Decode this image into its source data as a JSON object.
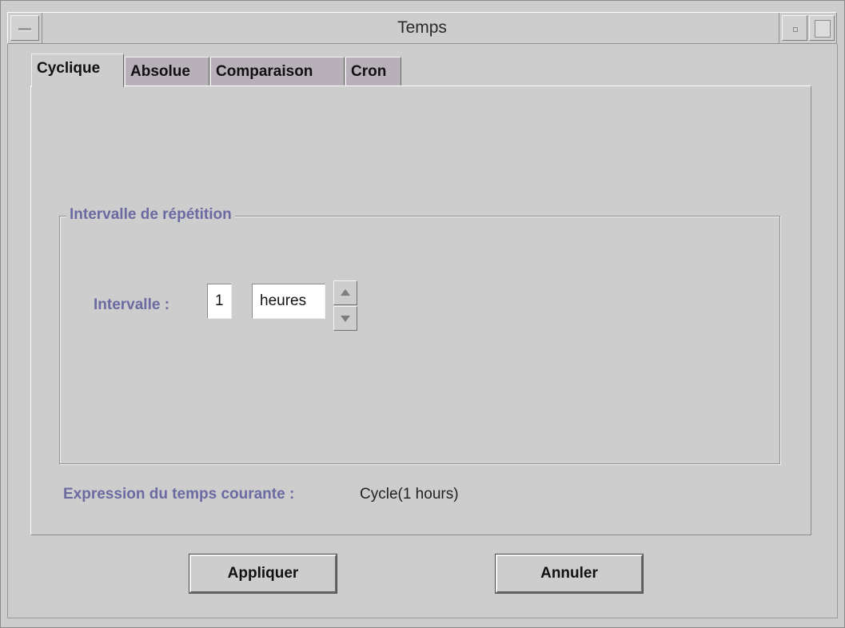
{
  "window": {
    "title": "Temps"
  },
  "tabs": [
    {
      "label": "Cyclique",
      "active": true
    },
    {
      "label": "Absolue",
      "active": false
    },
    {
      "label": "Comparaison",
      "active": false
    },
    {
      "label": "Cron",
      "active": false
    }
  ],
  "group": {
    "title": "Intervalle de répétition",
    "interval_label": "Intervalle :",
    "interval_value": "1",
    "unit_value": "heures"
  },
  "expression": {
    "label": "Expression du temps courante :",
    "value": "Cycle(1 hours)"
  },
  "buttons": {
    "apply": "Appliquer",
    "cancel": "Annuler"
  },
  "icons": {
    "window_menu": "window-menu-icon",
    "minimize": "minimize-icon",
    "maximize": "maximize-icon",
    "spinner_up": "arrow-up-icon",
    "spinner_down": "arrow-down-icon"
  },
  "colors": {
    "background": "#cdcdcd",
    "label_accent": "#6b6ba2",
    "inactive_tab": "#b7b0b8"
  }
}
